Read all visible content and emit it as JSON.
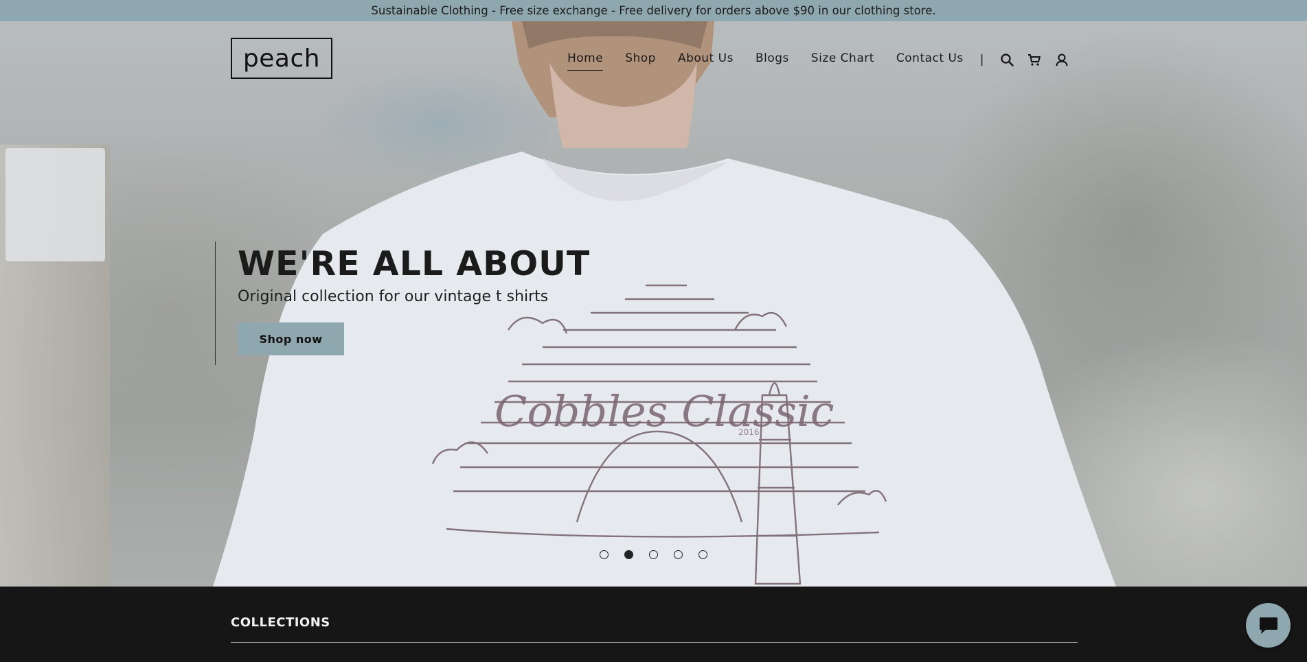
{
  "announcement": {
    "text": "Sustainable Clothing - Free size exchange - Free delivery for orders above $90 in our clothing store."
  },
  "header": {
    "logo_text": "peach",
    "nav": [
      {
        "label": "Home",
        "active": true
      },
      {
        "label": "Shop",
        "active": false
      },
      {
        "label": "About Us",
        "active": false
      },
      {
        "label": "Blogs",
        "active": false
      },
      {
        "label": "Size Chart",
        "active": false
      },
      {
        "label": "Contact Us",
        "active": false
      }
    ],
    "separator": "|",
    "icons": [
      "search-icon",
      "cart-icon",
      "account-icon"
    ]
  },
  "hero": {
    "title": "WE'RE ALL ABOUT",
    "subtitle": "Original collection for our vintage t shirts",
    "button_label": "Shop now",
    "print_script": "Cobbles Classic",
    "print_year": "2016",
    "slides": 5,
    "active_slide": 2
  },
  "collections": {
    "title": "COLLECTIONS"
  },
  "chat": {
    "icon": "chat-icon"
  },
  "colors": {
    "accent": "#8fa7af",
    "dark": "#161616",
    "text": "#1b1b1b"
  }
}
